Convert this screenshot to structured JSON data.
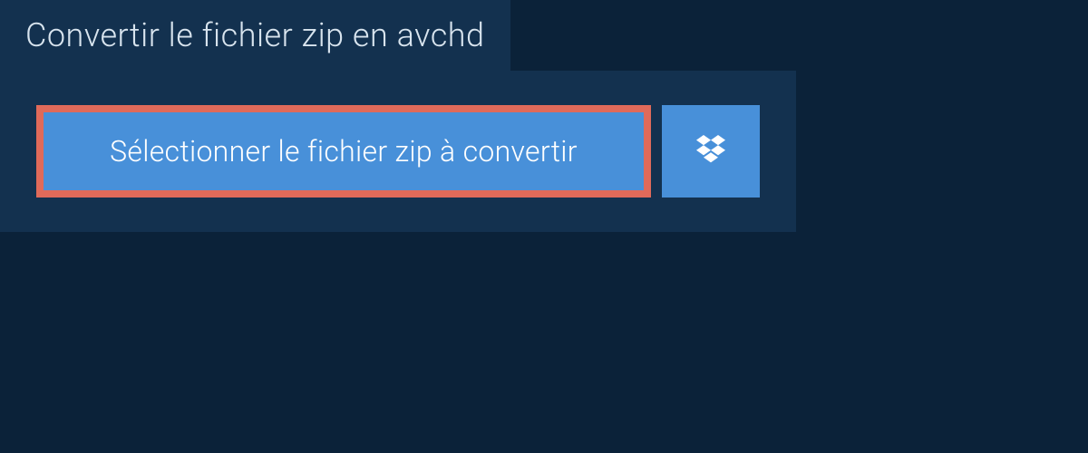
{
  "header": {
    "title": "Convertir le fichier zip en avchd"
  },
  "buttons": {
    "select_file_label": "Sélectionner le fichier zip à convertir"
  },
  "colors": {
    "background": "#0b2239",
    "panel": "#13314f",
    "button_bg": "#4890d9",
    "highlight_border": "#e06a5a",
    "text_light": "#d8e4ee"
  }
}
